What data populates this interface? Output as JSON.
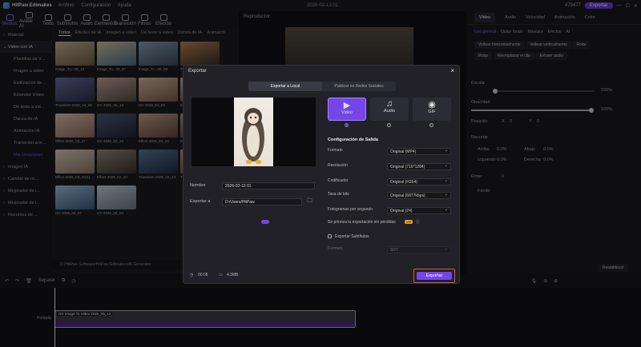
{
  "titlebar": {
    "app_name": "HitPaw Edimakes",
    "menu": [
      "Archivo",
      "Configuración",
      "Ayuda"
    ],
    "date": "2026-02-13 01",
    "credits": "479477",
    "export_label": "Exportar"
  },
  "toolbar": {
    "items": [
      "Medios",
      "Avatar AI",
      "Texto",
      "Subtítulos",
      "Audio",
      "Elementos",
      "Transición",
      "Filtros",
      "Efectos"
    ]
  },
  "sidebar": {
    "items": [
      "Material",
      "Video con IA",
      "Plantillas de V...",
      "Imagen a video",
      "Estilización de...",
      "Extender Vídeo",
      "De texto a vid...",
      "Danza de IA",
      "Animación IA",
      "Transición a le...",
      "Mis creaciones",
      "Imagen IA",
      "Cambio de ro...",
      "Mejorador de i...",
      "Mejorador de i...",
      "Recursos de ..."
    ]
  },
  "media": {
    "tabs": [
      "Todos",
      "Efectos de IA",
      "Imagen a video",
      "De texto a video",
      "Danza de IA",
      "Animació"
    ],
    "thumbs": [
      "Image_To...05_13",
      "Image_To...20_07",
      "Image_To...09_05",
      "Transition 2026_04_09",
      "Transition 2026_04_09",
      "I2V 2026_05_13",
      "I2V 2026_04_02",
      "Effect 2026_03_24",
      "Effect 2026_02_17",
      "I2V 2026_03_24",
      "Effect 2026_03_24",
      "Effect 2026_02_10",
      "Effect 2026_02_10(1)",
      "Effect 2026_02_10",
      "Transition 2026_03_13",
      "T2V 2026_02_24",
      "I2V 2026_02_07",
      "I2V 2026_02_04"
    ],
    "path": "D:/HitPaw Software/HitPaw Edimakes/AI Generator"
  },
  "player": {
    "title": "Reproductor"
  },
  "rpanel": {
    "tabs": [
      "Video",
      "Audio",
      "Velocidad",
      "Animación",
      "Color"
    ],
    "subtabs": [
      "Uso general",
      "Quitar fondo",
      "Máscara",
      "Efectos",
      "AI"
    ],
    "buttons": [
      "Voltear horizontalmente",
      "Voltear verticalmente",
      "Rotar",
      "Reemplazar el clip",
      "Extraer audio"
    ],
    "rotate_button": "Rotar",
    "scale_label": "Escala",
    "scale_value": "100%",
    "opacity_label": "Opacidad",
    "opacity_value": "100%",
    "position_label": "Posición",
    "pos_x": "X",
    "pos_x_val": "0",
    "pos_y": "Y",
    "pos_y_val": "0",
    "crop_label": "Recortar",
    "crop_fields": [
      "Arriba",
      "0.0%",
      "Abajo",
      "0.0%",
      "Izquierdo",
      "0.0%",
      "Derecha",
      "0.0%"
    ],
    "rotate_label": "Rotar",
    "rotate_value": "0",
    "background_label": "Fondo",
    "reset_label": "Restablecer"
  },
  "timeline": {
    "tool_split": "Separar",
    "track_label": "Portada",
    "clip_label": "I2V Image To Video 2026_05_13"
  },
  "dialog": {
    "title": "Exportar",
    "tabs": [
      "Exportar a Local",
      "Publicar en Redes Sociales"
    ],
    "formats": [
      "Video",
      "Audio",
      "GIF"
    ],
    "name_label": "Nombre",
    "name_value": "2026-02-13 01",
    "export_to_label": "Exportar a",
    "export_to_value": "D:/Users/HitPaw",
    "duration": "00:05",
    "size": "4.3MB",
    "config_title": "Configuración de Salida",
    "rows": [
      {
        "label": "Formato",
        "value": "Original (MP4)"
      },
      {
        "label": "Resolución",
        "value": "Original (716*1284)"
      },
      {
        "label": "Codificador",
        "value": "Original (H264)"
      },
      {
        "label": "Tasa de bits",
        "value": "Original (6877kbps)"
      },
      {
        "label": "Fotogramas por segundo",
        "value": "Original (24)"
      }
    ],
    "lossless_label": "Se prioriza la exportación sin pérdidas",
    "vip_badge": "VIP",
    "subtitles_label": "Exportar Subtítulos",
    "sub_format_label": "Formato",
    "sub_format_value": "SRT",
    "export_button": "Exportar"
  }
}
